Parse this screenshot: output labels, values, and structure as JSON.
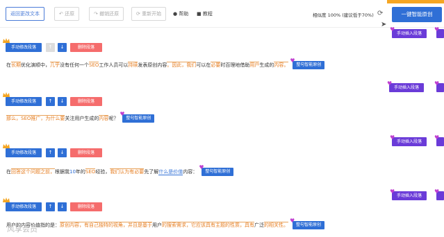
{
  "toolbar": {
    "back_label": "返回更改文本",
    "undo_label": "还原",
    "undo_all_label": "撤销还原",
    "restart_label": "重新开始",
    "help_label": "帮助",
    "tutorial_label": "教程",
    "similarity_text": "相似度 100% (建议低于70%)",
    "one_click_label": "一键智能原创"
  },
  "controls": {
    "edit_label": "手动修改段落",
    "delete_label": "删除段落",
    "smart_label": "整句智能原创",
    "insert_label": "手动插入段落"
  },
  "paragraphs": [
    {
      "segments": [
        {
          "t": "在",
          "k": ""
        },
        {
          "t": "长期",
          "k": "kw"
        },
        {
          "t": "优化演顺中，",
          "k": ""
        },
        {
          "t": "几乎",
          "k": "kw"
        },
        {
          "t": "没有任何一个",
          "k": ""
        },
        {
          "t": "SEO",
          "k": "kw"
        },
        {
          "t": "工作人员可以",
          "k": ""
        },
        {
          "t": "持续",
          "k": "kw"
        },
        {
          "t": "发表原创内容",
          "k": ""
        },
        {
          "t": "。因此，",
          "k": "kw"
        },
        {
          "t": "我们",
          "k": "kw"
        },
        {
          "t": "可以在",
          "k": ""
        },
        {
          "t": "必要",
          "k": "kw"
        },
        {
          "t": "时百理地借助",
          "k": ""
        },
        {
          "t": "用户",
          "k": "kw"
        },
        {
          "t": "生成的",
          "k": ""
        },
        {
          "t": "内容。",
          "k": "kw"
        }
      ]
    },
    {
      "segments": [
        {
          "t": "那么，",
          "k": "kw"
        },
        {
          "t": "SEO推广，",
          "k": "kw"
        },
        {
          "t": "为什么要",
          "k": "kw"
        },
        {
          "t": "关注用户生成的",
          "k": ""
        },
        {
          "t": "内容",
          "k": "kw"
        },
        {
          "t": "呢？",
          "k": ""
        }
      ]
    },
    {
      "segments": [
        {
          "t": "在",
          "k": ""
        },
        {
          "t": "回答这个问题之前，",
          "k": "kw"
        },
        {
          "t": "根据我",
          "k": ""
        },
        {
          "t": "10",
          "k": "kw2"
        },
        {
          "t": "年的",
          "k": ""
        },
        {
          "t": "SEO",
          "k": "kw"
        },
        {
          "t": "经验，",
          "k": ""
        },
        {
          "t": "我们认为有必要",
          "k": "kw"
        },
        {
          "t": "先了解",
          "k": ""
        },
        {
          "t": "什么是价值",
          "k": "link"
        },
        {
          "t": "内容：",
          "k": ""
        }
      ]
    },
    {
      "segments": [
        {
          "t": "用户的内容价值指的是：",
          "k": ""
        },
        {
          "t": "原创内容，",
          "k": "kw"
        },
        {
          "t": "有自己独特的视角，",
          "k": "kw"
        },
        {
          "t": "并且是基于",
          "k": "kw"
        },
        {
          "t": "用户",
          "k": ""
        },
        {
          "t": "的搜索需求，",
          "k": "kw"
        },
        {
          "t": "它应该具有主题的性质，",
          "k": "kw"
        },
        {
          "t": "具有",
          "k": "kw"
        },
        {
          "t": "广泛",
          "k": ""
        },
        {
          "t": "的相关性。",
          "k": "kw"
        }
      ]
    }
  ],
  "watermark": "风享会员",
  "colors": {
    "primary": "#2f6fd6",
    "danger": "#f56c6c",
    "insert": "#6a3bd8",
    "keyword": "#e67e22"
  }
}
